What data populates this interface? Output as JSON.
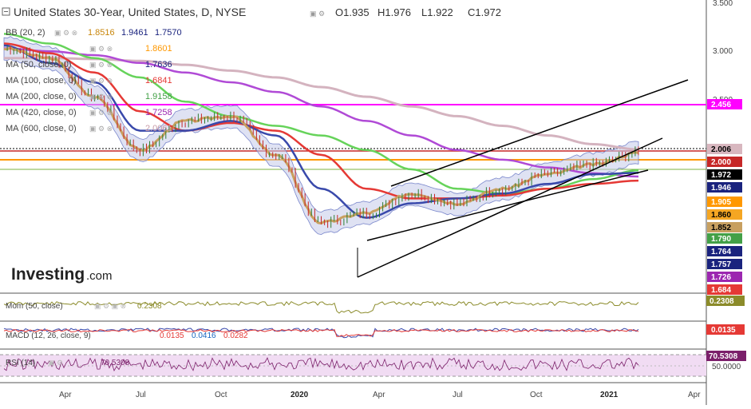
{
  "header": {
    "title": "United States 30-Year, United States, D, NYSE",
    "ohlc": [
      "O1.935",
      "H1.976",
      "L1.922",
      "C1.972"
    ]
  },
  "indicators": [
    {
      "label": "BB (20, 2)",
      "values": [
        {
          "text": "1.8516",
          "color": "#c8860b"
        },
        {
          "text": "1.9461",
          "color": "#1a237e"
        },
        {
          "text": "1.7570",
          "color": "#1a237e"
        }
      ]
    },
    {
      "label": "",
      "values": [
        {
          "text": "1.8601",
          "color": "#ff9800"
        }
      ]
    },
    {
      "label": "MA (50, close, 0)",
      "values": [
        {
          "text": "1.7636",
          "color": "#1a237e"
        }
      ]
    },
    {
      "label": "MA (100, close, 0)",
      "values": [
        {
          "text": "1.6841",
          "color": "#e53935"
        }
      ]
    },
    {
      "label": "MA (200, close, 0)",
      "values": [
        {
          "text": "1.9158",
          "color": "#43a047"
        }
      ]
    },
    {
      "label": "MA (420, close, 0)",
      "values": [
        {
          "text": "1.7258",
          "color": "#9c27b0"
        }
      ]
    },
    {
      "label": "MA (600, close, 0)",
      "values": [
        {
          "text": "2.0061",
          "color": "#c89ba7"
        }
      ]
    }
  ],
  "logo": {
    "main": "Investing",
    "suffix": ".com"
  },
  "axis": {
    "price_ticks": [
      "3.500",
      "3.000",
      "2.500"
    ],
    "x_ticks": [
      "Apr",
      "Jul",
      "Oct",
      "2020",
      "Apr",
      "Jul",
      "Oct",
      "2021",
      "Apr"
    ]
  },
  "price_labels": [
    {
      "text": "2.456",
      "bg": "#ff00ff",
      "fg": "#ffffff"
    },
    {
      "text": "2.006",
      "bg": "#d8b7bf",
      "fg": "#000000"
    },
    {
      "text": "2.000",
      "bg": "#c62828",
      "fg": "#ffffff"
    },
    {
      "text": "1.972",
      "bg": "#000000",
      "fg": "#ffffff"
    },
    {
      "text": "1.946",
      "bg": "#1a237e",
      "fg": "#ffffff"
    },
    {
      "text": "1.905",
      "bg": "#ff9800",
      "fg": "#ffffff"
    },
    {
      "text": "1.860",
      "bg": "#f5a623",
      "fg": "#000000"
    },
    {
      "text": "1.852",
      "bg": "#c8a060",
      "fg": "#000000"
    },
    {
      "text": "1.790",
      "bg": "#43a047",
      "fg": "#ffffff"
    },
    {
      "text": "1.764",
      "bg": "#1a237e",
      "fg": "#ffffff"
    },
    {
      "text": "1.757",
      "bg": "#1a237e",
      "fg": "#ffffff"
    },
    {
      "text": "1.726",
      "bg": "#9c27b0",
      "fg": "#ffffff"
    },
    {
      "text": "1.684",
      "bg": "#e53935",
      "fg": "#ffffff"
    }
  ],
  "panes": {
    "mom": {
      "label": "Mom (50, close)",
      "value": "0.2308",
      "badge": "0.2308",
      "badge_bg": "#8b8b2a"
    },
    "macd": {
      "label": "MACD (12, 26, close, 9)",
      "values": [
        {
          "text": "0.0135",
          "color": "#e53935"
        },
        {
          "text": "0.0416",
          "color": "#1565c0"
        },
        {
          "text": "0.0282",
          "color": "#e53935"
        }
      ],
      "badge": "0.0135",
      "badge_bg": "#e53935"
    },
    "rsi": {
      "label": "RSI (14)",
      "value": "70.5308",
      "badge": "70.5308",
      "badge_bg": "#7b1f6a",
      "level": "50.0000"
    }
  },
  "chart_data": {
    "type": "line",
    "title": "United States 30-Year, United States, D, NYSE",
    "ohlc": {
      "open": 1.935,
      "high": 1.976,
      "low": 1.922,
      "close": 1.972
    },
    "x": [
      "2019-02",
      "2019-04",
      "2019-06",
      "2019-08",
      "2019-10",
      "2019-12",
      "2020-02",
      "2020-03",
      "2020-04",
      "2020-06",
      "2020-08",
      "2020-10",
      "2020-12",
      "2021-01",
      "2021-02"
    ],
    "ylim": [
      1.0,
      3.6
    ],
    "y_ticks": [
      3.5,
      3.0,
      2.5
    ],
    "series": [
      {
        "name": "Price",
        "values": [
          3.05,
          2.95,
          2.55,
          2.0,
          2.3,
          2.35,
          1.95,
          1.25,
          1.35,
          1.55,
          1.45,
          1.6,
          1.75,
          1.85,
          1.97
        ]
      },
      {
        "name": "MA (50, close, 0)",
        "values": [
          3.08,
          2.9,
          2.7,
          2.2,
          2.2,
          2.3,
          2.15,
          1.6,
          1.3,
          1.45,
          1.5,
          1.55,
          1.65,
          1.75,
          1.764
        ]
      },
      {
        "name": "MA (100, close, 0)",
        "values": [
          3.1,
          3.0,
          2.8,
          2.4,
          2.2,
          2.28,
          2.2,
          1.95,
          1.6,
          1.5,
          1.5,
          1.53,
          1.6,
          1.65,
          1.684
        ]
      },
      {
        "name": "MA (200, close, 0)",
        "values": [
          3.2,
          3.1,
          2.95,
          2.75,
          2.5,
          2.35,
          2.25,
          2.15,
          2.0,
          1.8,
          1.6,
          1.55,
          1.6,
          1.7,
          1.79
        ]
      },
      {
        "name": "MA (420, close, 0)",
        "values": [
          3.05,
          3.02,
          2.98,
          2.9,
          2.8,
          2.7,
          2.6,
          2.45,
          2.3,
          2.15,
          2.0,
          1.9,
          1.82,
          1.76,
          1.726
        ]
      },
      {
        "name": "MA (600, close, 0)",
        "values": [
          2.95,
          2.95,
          2.94,
          2.92,
          2.88,
          2.82,
          2.75,
          2.65,
          2.55,
          2.45,
          2.35,
          2.25,
          2.15,
          2.06,
          2.006
        ]
      }
    ],
    "horizontal_lines": [
      2.456,
      2.006,
      2.0,
      1.972,
      1.905
    ],
    "trend_channel": "upward",
    "grid": false
  }
}
